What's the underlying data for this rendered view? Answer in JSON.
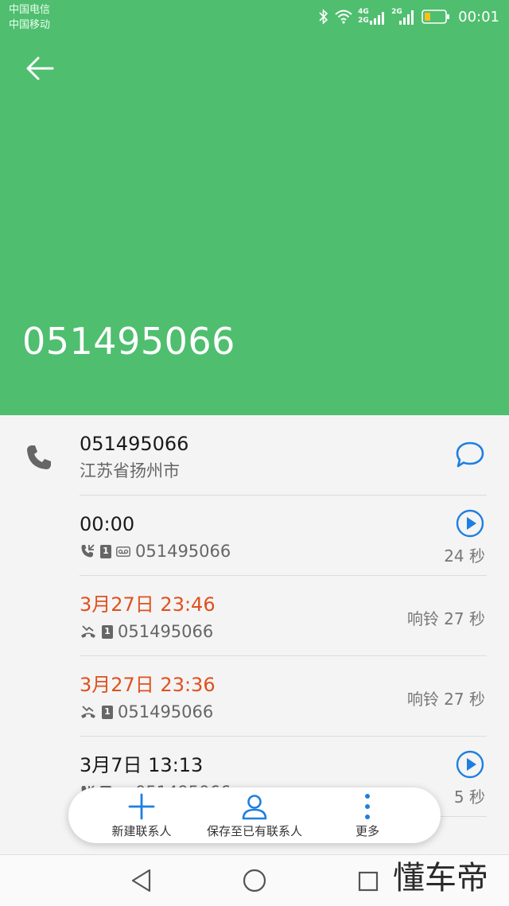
{
  "status": {
    "carrier1": "中国电信",
    "carrier2": "中国移动",
    "network_4g": "4G",
    "network_2g_a": "2G",
    "network_2g_b": "2G",
    "time": "00:01"
  },
  "header": {
    "number": "051495066",
    "background_color": "#4fbe6f"
  },
  "contact": {
    "number": "051495066",
    "location": "江苏省扬州市"
  },
  "calls": [
    {
      "title": "00:00",
      "number": "051495066",
      "right": "24 秒",
      "missed": false,
      "voicemail": true,
      "play": true
    },
    {
      "title": "3月27日 23:46",
      "number": "051495066",
      "right": "响铃 27 秒",
      "missed": true,
      "voicemail": false,
      "play": false
    },
    {
      "title": "3月27日 23:36",
      "number": "051495066",
      "right": "响铃 27 秒",
      "missed": true,
      "voicemail": false,
      "play": false
    },
    {
      "title": "3月7日 13:13",
      "number": "051495066",
      "right": "5 秒",
      "missed": false,
      "voicemail": true,
      "play": true
    }
  ],
  "sim_label": "1",
  "actions": {
    "new_contact": "新建联系人",
    "save_existing": "保存至已有联系人",
    "more": "更多"
  },
  "accent_color": "#1e7fe0",
  "missed_color": "#e0501e",
  "watermark": "懂车帝"
}
